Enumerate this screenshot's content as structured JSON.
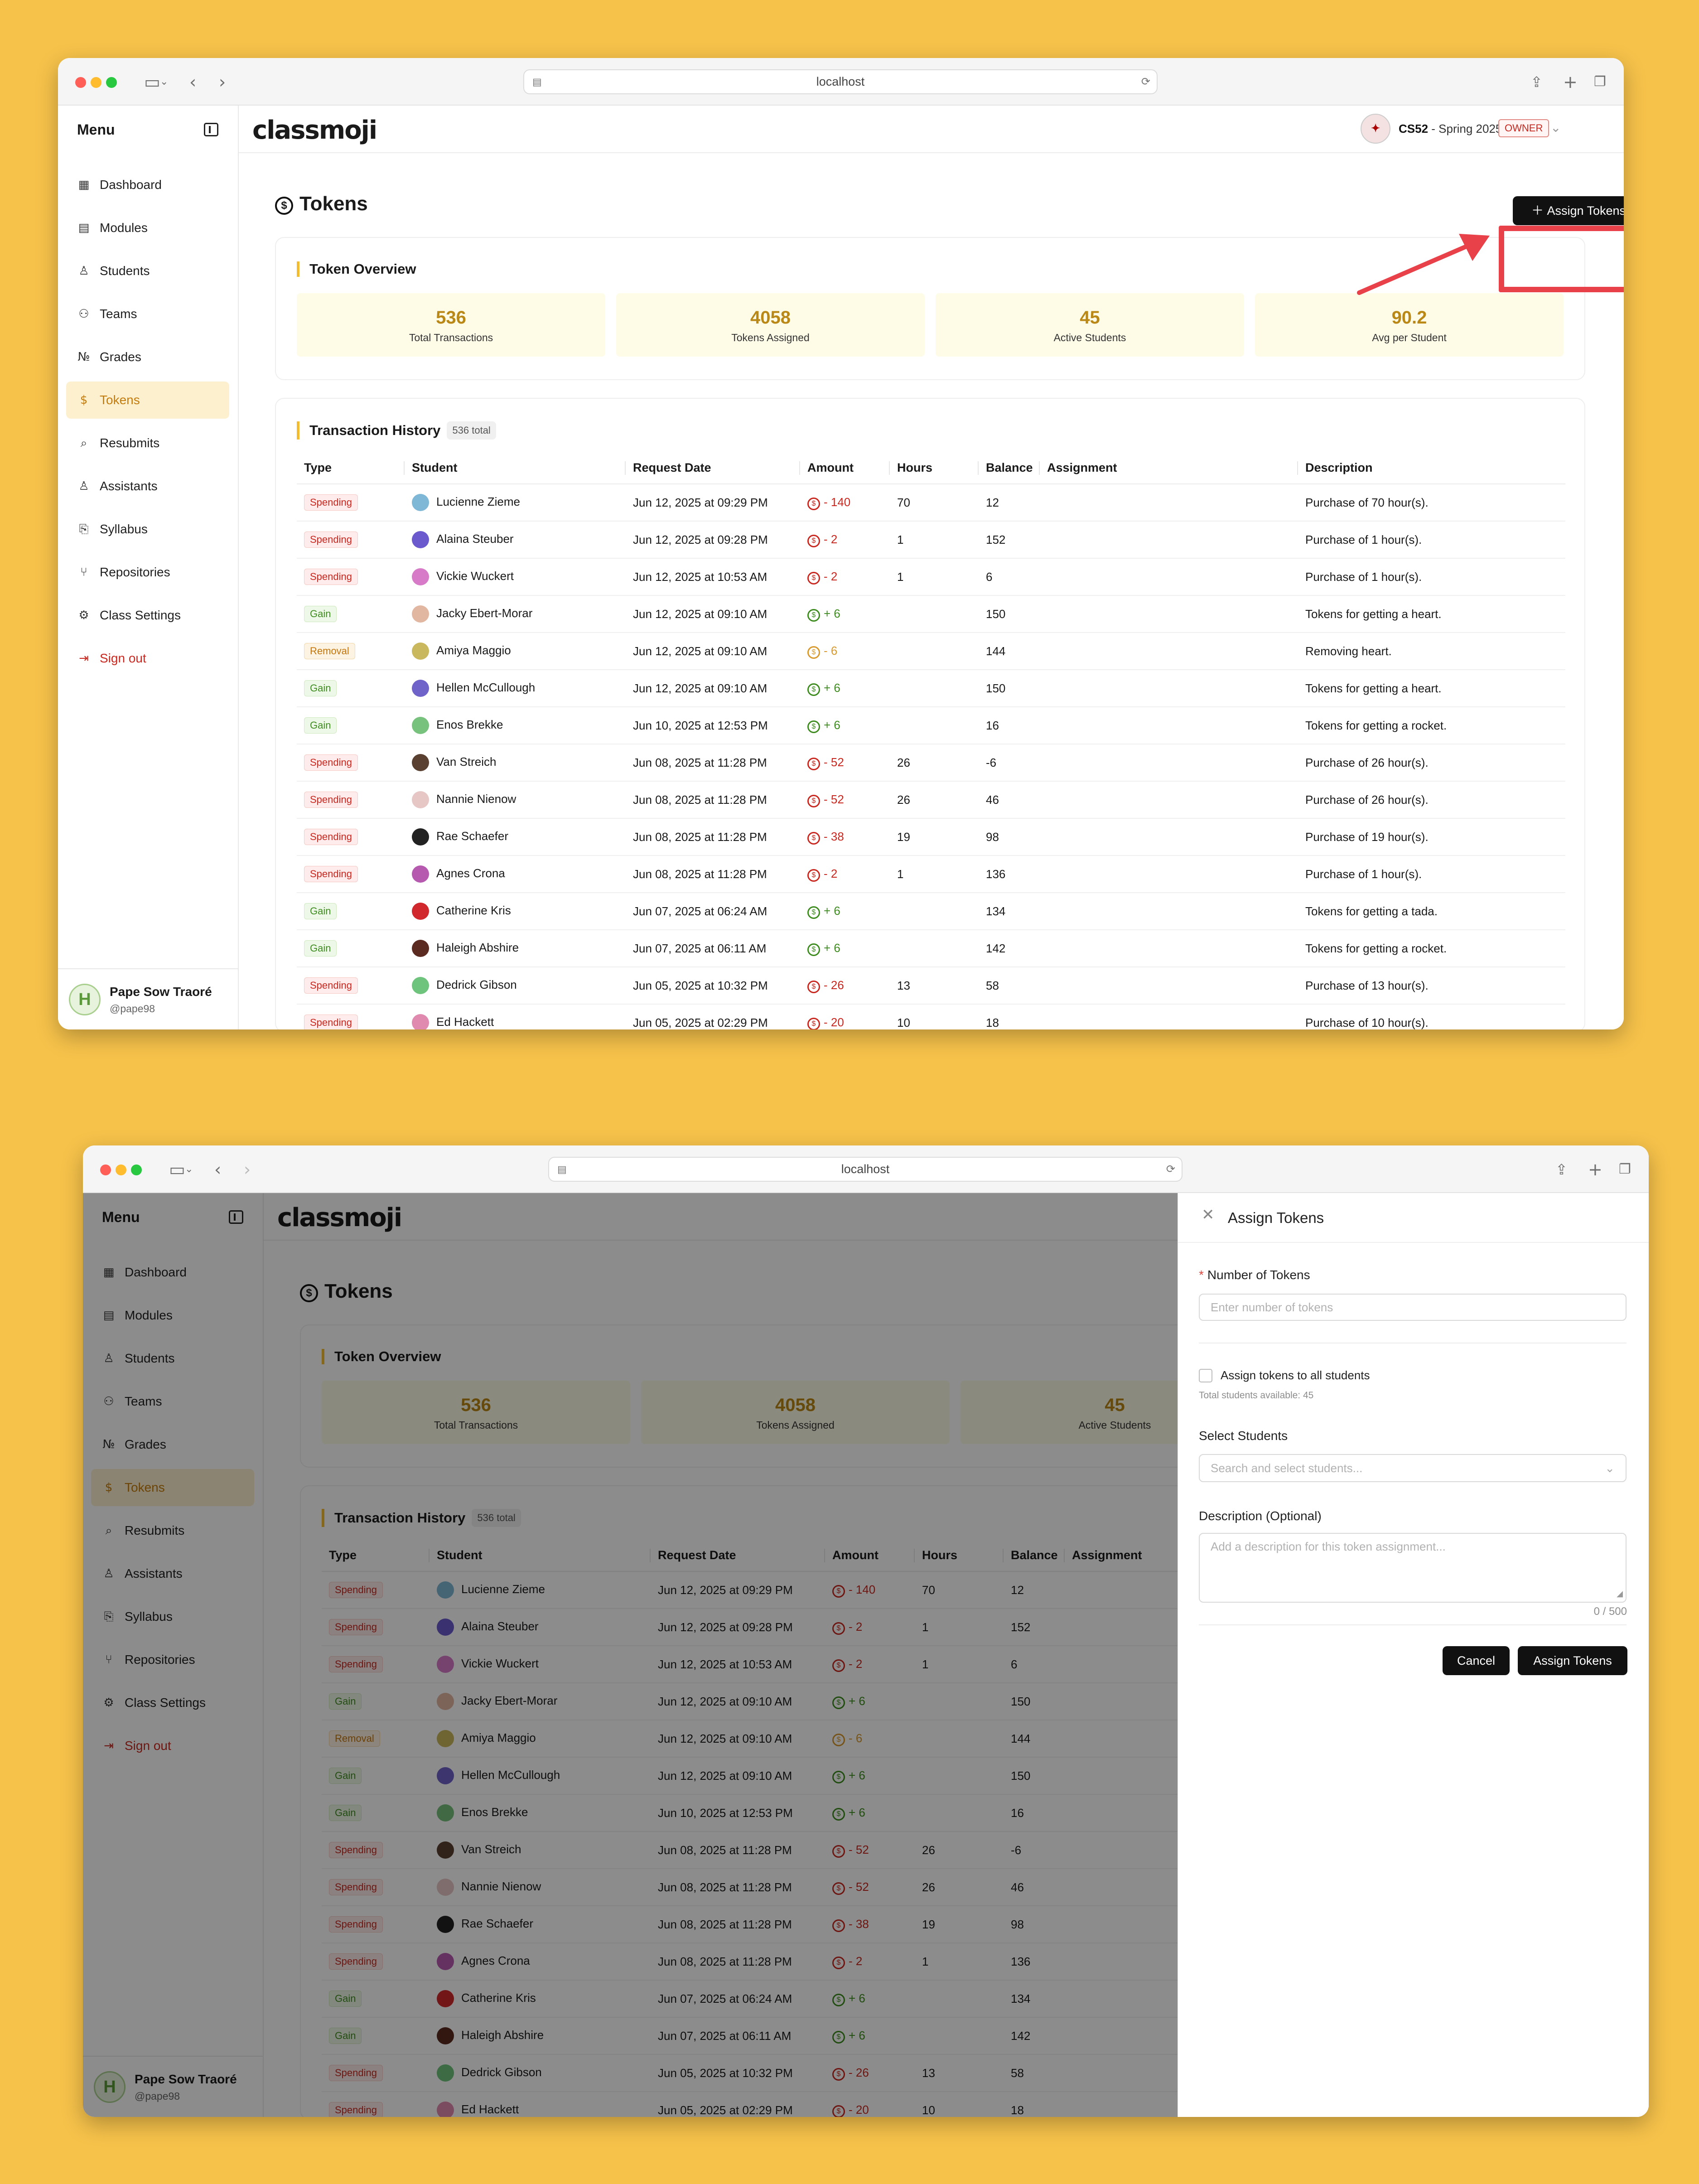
{
  "browser": {
    "url": "localhost"
  },
  "sidebar": {
    "title": "Menu",
    "items": [
      {
        "label": "Dashboard",
        "icon": "dashboard-icon"
      },
      {
        "label": "Modules",
        "icon": "file-icon"
      },
      {
        "label": "Students",
        "icon": "users-icon"
      },
      {
        "label": "Teams",
        "icon": "team-icon"
      },
      {
        "label": "Grades",
        "icon": "number-icon"
      },
      {
        "label": "Tokens",
        "icon": "coin-icon"
      },
      {
        "label": "Resubmits",
        "icon": "search-icon"
      },
      {
        "label": "Assistants",
        "icon": "user-icon"
      },
      {
        "label": "Syllabus",
        "icon": "book-icon"
      },
      {
        "label": "Repositories",
        "icon": "git-icon"
      },
      {
        "label": "Class Settings",
        "icon": "gear-icon"
      },
      {
        "label": "Sign out",
        "icon": "sign-out-icon"
      }
    ],
    "active_index": 5,
    "user": {
      "name": "Pape Sow Traoré",
      "handle": "@pape98",
      "initial": "H"
    }
  },
  "header": {
    "logo": "classmoji",
    "course_code": "CS52",
    "course_term": " - Spring 2025",
    "role": "OWNER"
  },
  "page": {
    "title": "Tokens",
    "assign_button": "Assign Tokens",
    "overview_title": "Token Overview",
    "stats": [
      {
        "value": "536",
        "label": "Total Transactions"
      },
      {
        "value": "4058",
        "label": "Tokens Assigned"
      },
      {
        "value": "45",
        "label": "Active Students"
      },
      {
        "value": "90.2",
        "label": "Avg per Student"
      }
    ],
    "history_title": "Transaction History",
    "history_total": "536 total",
    "columns": [
      "Type",
      "Student",
      "Request Date",
      "Amount",
      "Hours",
      "Balance",
      "Assignment",
      "Description"
    ],
    "rows": [
      {
        "type": "Spending",
        "student": "Lucienne Zieme",
        "avatar_color": "#7fb8d6",
        "date": "Jun 12, 2025 at 09:29 PM",
        "amount": "- 140",
        "hours": "70",
        "balance": "12",
        "assignment": "",
        "description": "Purchase of 70 hour(s)."
      },
      {
        "type": "Spending",
        "student": "Alaina Steuber",
        "avatar_color": "#6a5acd",
        "date": "Jun 12, 2025 at 09:28 PM",
        "amount": "- 2",
        "hours": "1",
        "balance": "152",
        "assignment": "",
        "description": "Purchase of 1 hour(s)."
      },
      {
        "type": "Spending",
        "student": "Vickie Wuckert",
        "avatar_color": "#d77bc8",
        "date": "Jun 12, 2025 at 10:53 AM",
        "amount": "- 2",
        "hours": "1",
        "balance": "6",
        "assignment": "",
        "description": "Purchase of 1 hour(s)."
      },
      {
        "type": "Gain",
        "student": "Jacky Ebert-Morar",
        "avatar_color": "#e2b7a2",
        "date": "Jun 12, 2025 at 09:10 AM",
        "amount": "+ 6",
        "hours": "",
        "balance": "150",
        "assignment": "",
        "description": "Tokens for getting a heart."
      },
      {
        "type": "Removal",
        "student": "Amiya Maggio",
        "avatar_color": "#c9b85e",
        "date": "Jun 12, 2025 at 09:10 AM",
        "amount": "- 6",
        "hours": "",
        "balance": "144",
        "assignment": "",
        "description": "Removing heart."
      },
      {
        "type": "Gain",
        "student": "Hellen McCullough",
        "avatar_color": "#6f63c9",
        "date": "Jun 12, 2025 at 09:10 AM",
        "amount": "+ 6",
        "hours": "",
        "balance": "150",
        "assignment": "",
        "description": "Tokens for getting a heart."
      },
      {
        "type": "Gain",
        "student": "Enos Brekke",
        "avatar_color": "#77c27d",
        "date": "Jun 10, 2025 at 12:53 PM",
        "amount": "+ 6",
        "hours": "",
        "balance": "16",
        "assignment": "",
        "description": "Tokens for getting a rocket."
      },
      {
        "type": "Spending",
        "student": "Van Streich",
        "avatar_color": "#5a4030",
        "date": "Jun 08, 2025 at 11:28 PM",
        "amount": "- 52",
        "hours": "26",
        "balance": "-6",
        "assignment": "",
        "description": "Purchase of 26 hour(s)."
      },
      {
        "type": "Spending",
        "student": "Nannie Nienow",
        "avatar_color": "#e7c6c6",
        "date": "Jun 08, 2025 at 11:28 PM",
        "amount": "- 52",
        "hours": "26",
        "balance": "46",
        "assignment": "",
        "description": "Purchase of 26 hour(s)."
      },
      {
        "type": "Spending",
        "student": "Rae Schaefer",
        "avatar_color": "#222222",
        "date": "Jun 08, 2025 at 11:28 PM",
        "amount": "- 38",
        "hours": "19",
        "balance": "98",
        "assignment": "",
        "description": "Purchase of 19 hour(s)."
      },
      {
        "type": "Spending",
        "student": "Agnes Crona",
        "avatar_color": "#b65ab0",
        "date": "Jun 08, 2025 at 11:28 PM",
        "amount": "- 2",
        "hours": "1",
        "balance": "136",
        "assignment": "",
        "description": "Purchase of 1 hour(s)."
      },
      {
        "type": "Gain",
        "student": "Catherine Kris",
        "avatar_color": "#d0282c",
        "date": "Jun 07, 2025 at 06:24 AM",
        "amount": "+ 6",
        "hours": "",
        "balance": "134",
        "assignment": "",
        "description": "Tokens for getting a tada."
      },
      {
        "type": "Gain",
        "student": "Haleigh Abshire",
        "avatar_color": "#5b2a20",
        "date": "Jun 07, 2025 at 06:11 AM",
        "amount": "+ 6",
        "hours": "",
        "balance": "142",
        "assignment": "",
        "description": "Tokens for getting a rocket."
      },
      {
        "type": "Spending",
        "student": "Dedrick Gibson",
        "avatar_color": "#6fc47d",
        "date": "Jun 05, 2025 at 10:32 PM",
        "amount": "- 26",
        "hours": "13",
        "balance": "58",
        "assignment": "",
        "description": "Purchase of 13 hour(s)."
      },
      {
        "type": "Spending",
        "student": "Ed Hackett",
        "avatar_color": "#e08ab0",
        "date": "Jun 05, 2025 at 02:29 PM",
        "amount": "- 20",
        "hours": "10",
        "balance": "18",
        "assignment": "",
        "description": "Purchase of 10 hour(s)."
      }
    ]
  },
  "drawer": {
    "title": "Assign Tokens",
    "number_label": "Number of Tokens",
    "number_placeholder": "Enter number of tokens",
    "all_students_label": "Assign tokens to all students",
    "total_available": "Total students available: 45",
    "select_label": "Select Students",
    "select_placeholder": "Search and select students...",
    "description_label": "Description (Optional)",
    "description_placeholder": "Add a description for this token assignment...",
    "counter": "0 / 500",
    "cancel": "Cancel",
    "submit": "Assign Tokens"
  },
  "colors": {
    "accent": "#f2bd33",
    "active_nav": "#c47c0c",
    "danger": "#c8281f",
    "success": "#3e8c1f",
    "annotation": "#e8414a",
    "background": "#f6c24a"
  }
}
